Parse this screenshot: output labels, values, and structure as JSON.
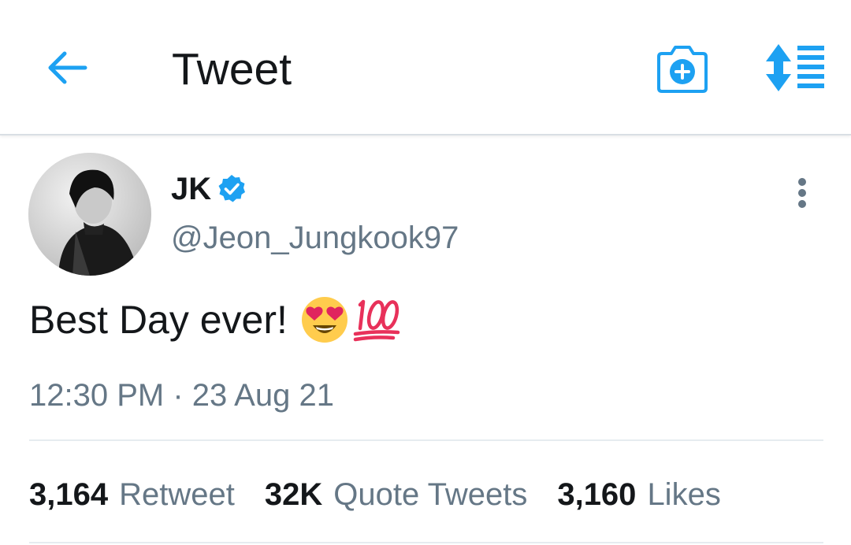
{
  "colors": {
    "accent": "#1da1f2",
    "text_primary": "#14171a",
    "text_secondary": "#657786",
    "divider": "#e6ecf0"
  },
  "header": {
    "title": "Tweet",
    "back_icon": "arrow-left-icon",
    "camera_icon": "camera-plus-icon",
    "sort_icon": "sort-list-icon"
  },
  "tweet": {
    "author": {
      "name": "JK",
      "verified": true,
      "handle": "@Jeon_Jungkook97"
    },
    "text": "Best Day ever!",
    "emojis": [
      "heart-eyes-emoji",
      "hundred-points-emoji"
    ],
    "timestamp": "12:30 PM · 23 Aug 21",
    "stats": [
      {
        "count": "3,164",
        "label": "Retweet"
      },
      {
        "count": "32K",
        "label": "Quote Tweets"
      },
      {
        "count": "3,160",
        "label": "Likes"
      }
    ]
  }
}
